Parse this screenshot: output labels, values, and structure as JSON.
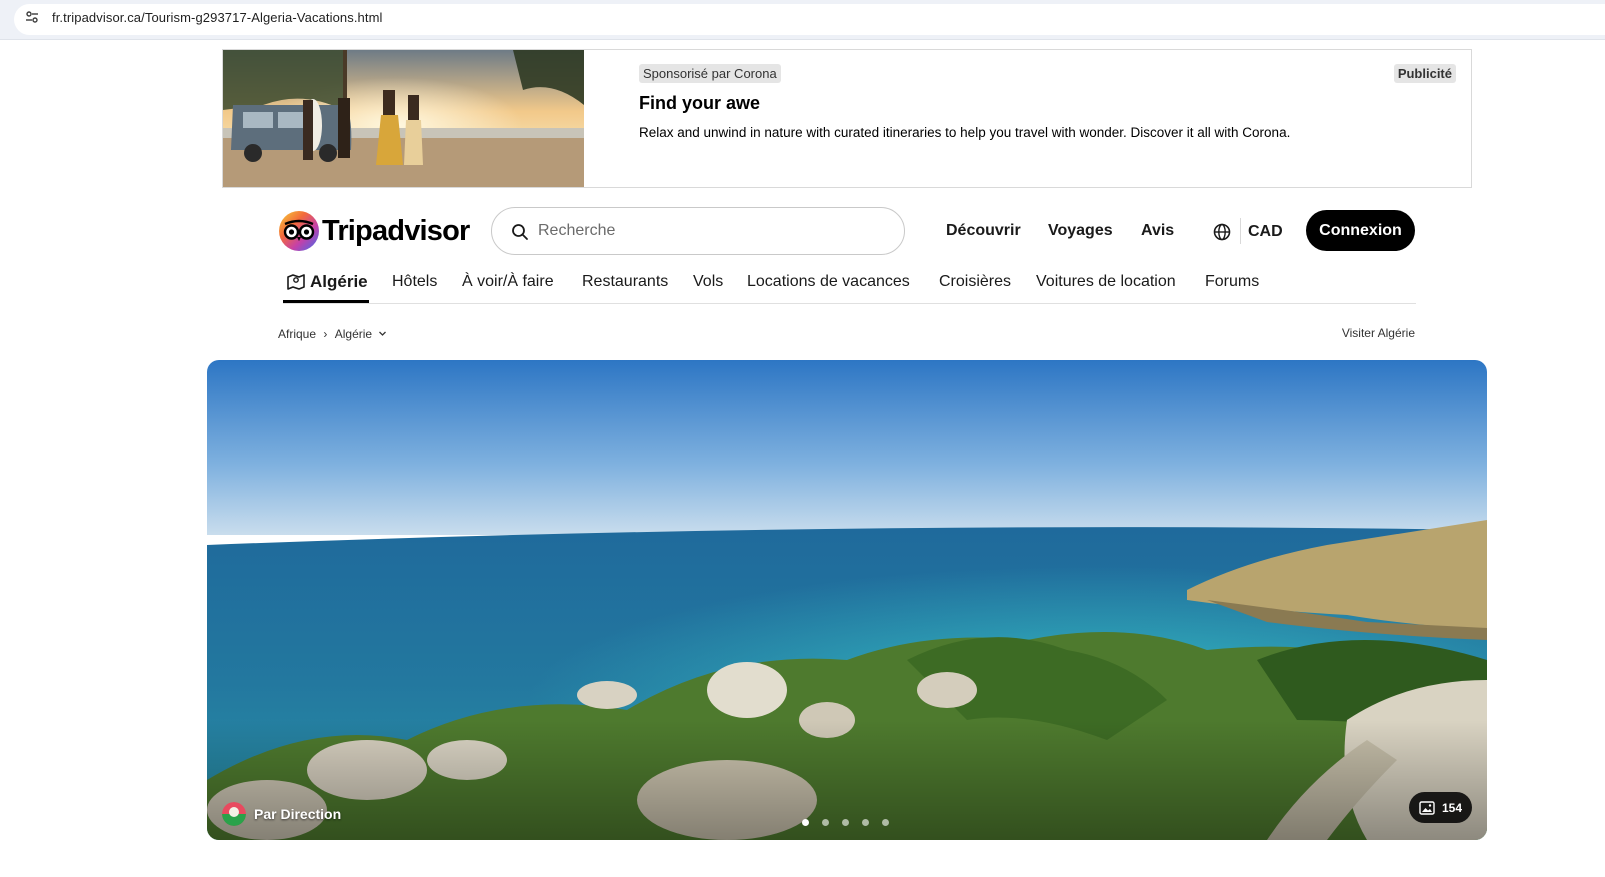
{
  "browser": {
    "url": "fr.tripadvisor.ca/Tourism-g293717-Algeria-Vacations.html"
  },
  "ad": {
    "sponsor_label": "Sponsorisé par Corona",
    "title": "Find your awe",
    "text": "Relax and unwind in nature with curated itineraries to help you travel with wonder. Discover it all with Corona.",
    "ad_label": "Publicité"
  },
  "header": {
    "logo_text": "Tripadvisor",
    "search_placeholder": "Recherche",
    "nav": [
      "Découvrir",
      "Voyages",
      "Avis"
    ],
    "currency": "CAD",
    "login_label": "Connexion"
  },
  "subnav": {
    "active": "Algérie",
    "items": [
      "Hôtels",
      "À voir/À faire",
      "Restaurants",
      "Vols",
      "Locations de vacances",
      "Croisières",
      "Voitures de location",
      "Forums"
    ]
  },
  "breadcrumb": {
    "parent": "Afrique",
    "current": "Algérie",
    "visit_link": "Visiter Algérie"
  },
  "hero": {
    "credit": "Par Direction",
    "photo_count": "154",
    "slides_total": 5,
    "slide_active": 1
  },
  "colors": {
    "brand_black": "#000000",
    "page_bg": "#ffffff"
  }
}
